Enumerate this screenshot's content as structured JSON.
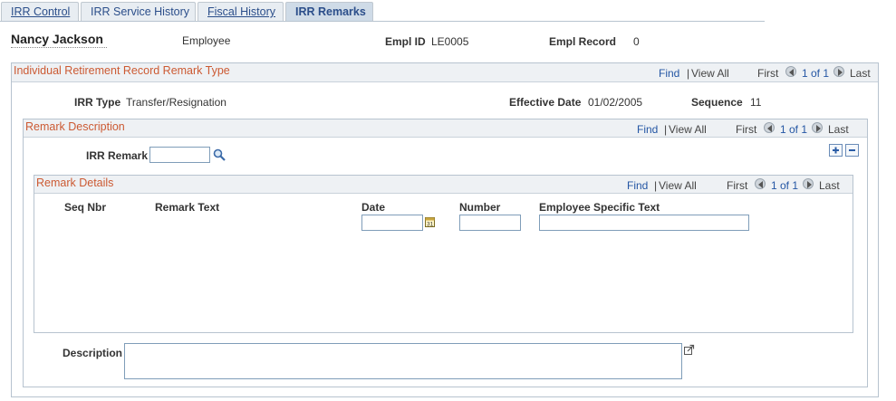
{
  "tabs": [
    {
      "label": "IRR Control"
    },
    {
      "label": "IRR Service History"
    },
    {
      "label": "Fiscal History"
    },
    {
      "label": "IRR Remarks"
    }
  ],
  "header": {
    "name": "Nancy Jackson",
    "role": "Employee",
    "empl_id_label": "Empl ID",
    "empl_id": "LE0005",
    "empl_record_label": "Empl Record",
    "empl_record": "0"
  },
  "nav": {
    "find": "Find",
    "sep": "|",
    "view_all": "View All",
    "first": "First",
    "count": "1 of 1",
    "last": "Last"
  },
  "section_type": {
    "title": "Individual Retirement Record Remark Type",
    "irr_type_label": "IRR Type",
    "irr_type": "Transfer/Resignation",
    "effective_date_label": "Effective Date",
    "effective_date": "01/02/2005",
    "sequence_label": "Sequence",
    "sequence": "11"
  },
  "section_desc": {
    "title": "Remark Description",
    "irr_remark_label": "IRR Remark",
    "irr_remark_value": ""
  },
  "section_details": {
    "title": "Remark Details",
    "columns": {
      "seq_nbr": "Seq Nbr",
      "remark_text": "Remark Text",
      "date": "Date",
      "number": "Number",
      "employee_specific_text": "Employee Specific Text"
    },
    "row": {
      "date": "",
      "number": "",
      "employee_specific_text": ""
    }
  },
  "description": {
    "label": "Description",
    "value": ""
  },
  "icons": {
    "lookup": "magnifier-icon",
    "calendar": "calendar-icon",
    "add": "plus-icon",
    "delete": "minus-icon",
    "expand": "expand-textarea-icon",
    "prev": "previous-arrow-icon",
    "next": "next-arrow-icon"
  },
  "colors": {
    "section_title": "#cc5a33",
    "link": "#2456a4",
    "tab_active": "#cfdbe7"
  }
}
